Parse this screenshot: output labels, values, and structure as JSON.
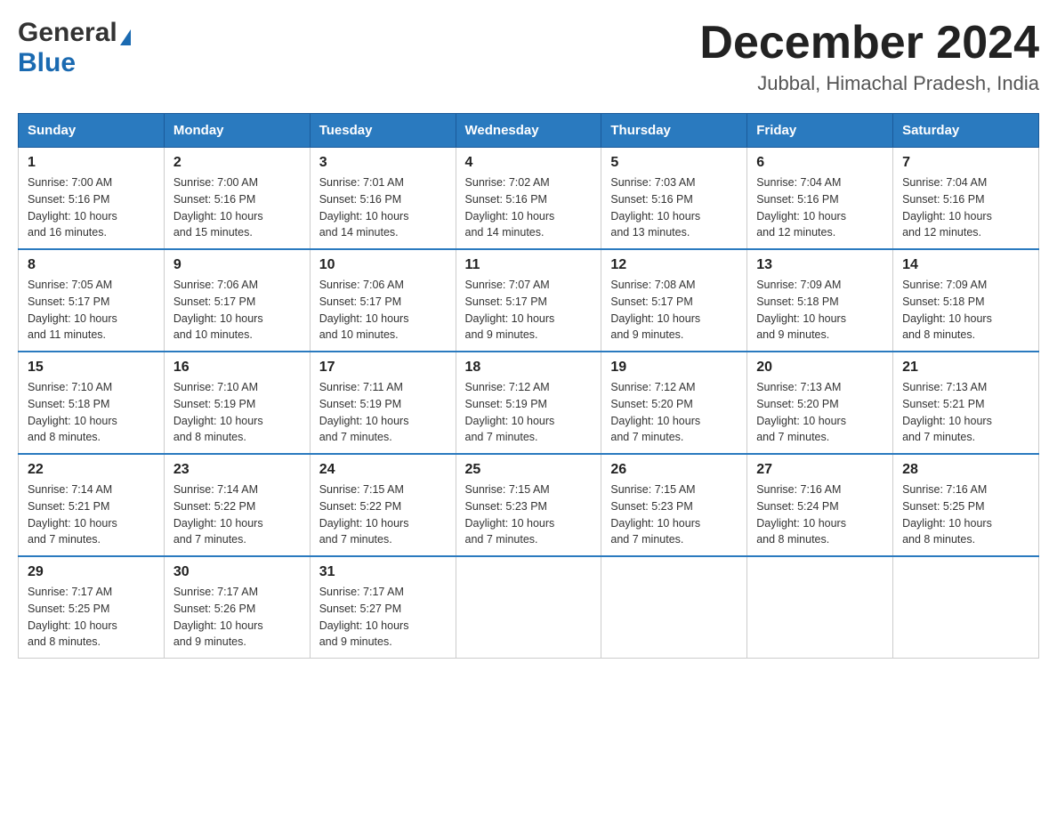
{
  "logo": {
    "general": "General",
    "blue": "Blue"
  },
  "header": {
    "month": "December 2024",
    "location": "Jubbal, Himachal Pradesh, India"
  },
  "weekdays": [
    "Sunday",
    "Monday",
    "Tuesday",
    "Wednesday",
    "Thursday",
    "Friday",
    "Saturday"
  ],
  "weeks": [
    [
      {
        "day": "1",
        "sunrise": "7:00 AM",
        "sunset": "5:16 PM",
        "daylight": "10 hours and 16 minutes."
      },
      {
        "day": "2",
        "sunrise": "7:00 AM",
        "sunset": "5:16 PM",
        "daylight": "10 hours and 15 minutes."
      },
      {
        "day": "3",
        "sunrise": "7:01 AM",
        "sunset": "5:16 PM",
        "daylight": "10 hours and 14 minutes."
      },
      {
        "day": "4",
        "sunrise": "7:02 AM",
        "sunset": "5:16 PM",
        "daylight": "10 hours and 14 minutes."
      },
      {
        "day": "5",
        "sunrise": "7:03 AM",
        "sunset": "5:16 PM",
        "daylight": "10 hours and 13 minutes."
      },
      {
        "day": "6",
        "sunrise": "7:04 AM",
        "sunset": "5:16 PM",
        "daylight": "10 hours and 12 minutes."
      },
      {
        "day": "7",
        "sunrise": "7:04 AM",
        "sunset": "5:16 PM",
        "daylight": "10 hours and 12 minutes."
      }
    ],
    [
      {
        "day": "8",
        "sunrise": "7:05 AM",
        "sunset": "5:17 PM",
        "daylight": "10 hours and 11 minutes."
      },
      {
        "day": "9",
        "sunrise": "7:06 AM",
        "sunset": "5:17 PM",
        "daylight": "10 hours and 10 minutes."
      },
      {
        "day": "10",
        "sunrise": "7:06 AM",
        "sunset": "5:17 PM",
        "daylight": "10 hours and 10 minutes."
      },
      {
        "day": "11",
        "sunrise": "7:07 AM",
        "sunset": "5:17 PM",
        "daylight": "10 hours and 9 minutes."
      },
      {
        "day": "12",
        "sunrise": "7:08 AM",
        "sunset": "5:17 PM",
        "daylight": "10 hours and 9 minutes."
      },
      {
        "day": "13",
        "sunrise": "7:09 AM",
        "sunset": "5:18 PM",
        "daylight": "10 hours and 9 minutes."
      },
      {
        "day": "14",
        "sunrise": "7:09 AM",
        "sunset": "5:18 PM",
        "daylight": "10 hours and 8 minutes."
      }
    ],
    [
      {
        "day": "15",
        "sunrise": "7:10 AM",
        "sunset": "5:18 PM",
        "daylight": "10 hours and 8 minutes."
      },
      {
        "day": "16",
        "sunrise": "7:10 AM",
        "sunset": "5:19 PM",
        "daylight": "10 hours and 8 minutes."
      },
      {
        "day": "17",
        "sunrise": "7:11 AM",
        "sunset": "5:19 PM",
        "daylight": "10 hours and 7 minutes."
      },
      {
        "day": "18",
        "sunrise": "7:12 AM",
        "sunset": "5:19 PM",
        "daylight": "10 hours and 7 minutes."
      },
      {
        "day": "19",
        "sunrise": "7:12 AM",
        "sunset": "5:20 PM",
        "daylight": "10 hours and 7 minutes."
      },
      {
        "day": "20",
        "sunrise": "7:13 AM",
        "sunset": "5:20 PM",
        "daylight": "10 hours and 7 minutes."
      },
      {
        "day": "21",
        "sunrise": "7:13 AM",
        "sunset": "5:21 PM",
        "daylight": "10 hours and 7 minutes."
      }
    ],
    [
      {
        "day": "22",
        "sunrise": "7:14 AM",
        "sunset": "5:21 PM",
        "daylight": "10 hours and 7 minutes."
      },
      {
        "day": "23",
        "sunrise": "7:14 AM",
        "sunset": "5:22 PM",
        "daylight": "10 hours and 7 minutes."
      },
      {
        "day": "24",
        "sunrise": "7:15 AM",
        "sunset": "5:22 PM",
        "daylight": "10 hours and 7 minutes."
      },
      {
        "day": "25",
        "sunrise": "7:15 AM",
        "sunset": "5:23 PM",
        "daylight": "10 hours and 7 minutes."
      },
      {
        "day": "26",
        "sunrise": "7:15 AM",
        "sunset": "5:23 PM",
        "daylight": "10 hours and 7 minutes."
      },
      {
        "day": "27",
        "sunrise": "7:16 AM",
        "sunset": "5:24 PM",
        "daylight": "10 hours and 8 minutes."
      },
      {
        "day": "28",
        "sunrise": "7:16 AM",
        "sunset": "5:25 PM",
        "daylight": "10 hours and 8 minutes."
      }
    ],
    [
      {
        "day": "29",
        "sunrise": "7:17 AM",
        "sunset": "5:25 PM",
        "daylight": "10 hours and 8 minutes."
      },
      {
        "day": "30",
        "sunrise": "7:17 AM",
        "sunset": "5:26 PM",
        "daylight": "10 hours and 9 minutes."
      },
      {
        "day": "31",
        "sunrise": "7:17 AM",
        "sunset": "5:27 PM",
        "daylight": "10 hours and 9 minutes."
      },
      null,
      null,
      null,
      null
    ]
  ],
  "labels": {
    "sunrise": "Sunrise: ",
    "sunset": "Sunset: ",
    "daylight": "Daylight: "
  }
}
